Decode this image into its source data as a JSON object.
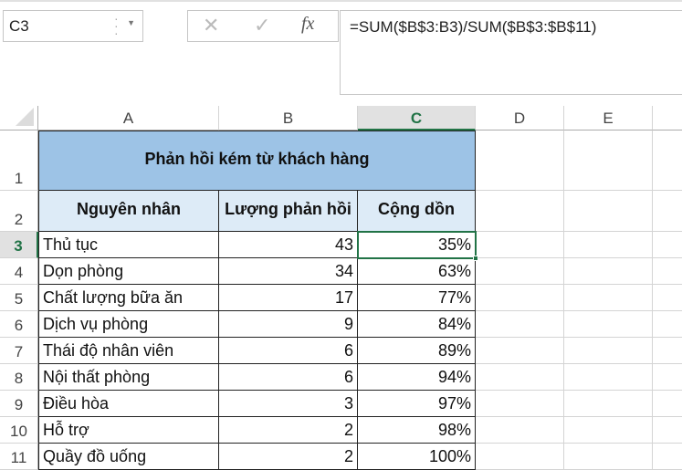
{
  "formula_bar": {
    "name_box": "C3",
    "cancel_icon": "✕",
    "enter_icon": "✓",
    "fx_label": "fx",
    "formula": "=SUM($B$3:B3)/SUM($B$3:$B$11)"
  },
  "columns": [
    "A",
    "B",
    "C",
    "D",
    "E"
  ],
  "rows": [
    "1",
    "2",
    "3",
    "4",
    "5",
    "6",
    "7",
    "8",
    "9",
    "10",
    "11"
  ],
  "table": {
    "title": "Phản hồi kém từ khách hàng",
    "headers": [
      "Nguyên nhân",
      "Lượng phản hồi",
      "Cộng dồn"
    ],
    "data": [
      [
        "Thủ tục",
        "43",
        "35%"
      ],
      [
        "Dọn phòng",
        "34",
        "63%"
      ],
      [
        "Chất lượng bữa ăn",
        "17",
        "77%"
      ],
      [
        "Dịch vụ phòng",
        "9",
        "84%"
      ],
      [
        "Thái độ nhân viên",
        "6",
        "89%"
      ],
      [
        "Nội thất phòng",
        "6",
        "94%"
      ],
      [
        "Điều hòa",
        "3",
        "97%"
      ],
      [
        "Hỗ trợ",
        "2",
        "98%"
      ],
      [
        "Quầy đồ uống",
        "2",
        "100%"
      ]
    ]
  },
  "selected_cell": "C3"
}
